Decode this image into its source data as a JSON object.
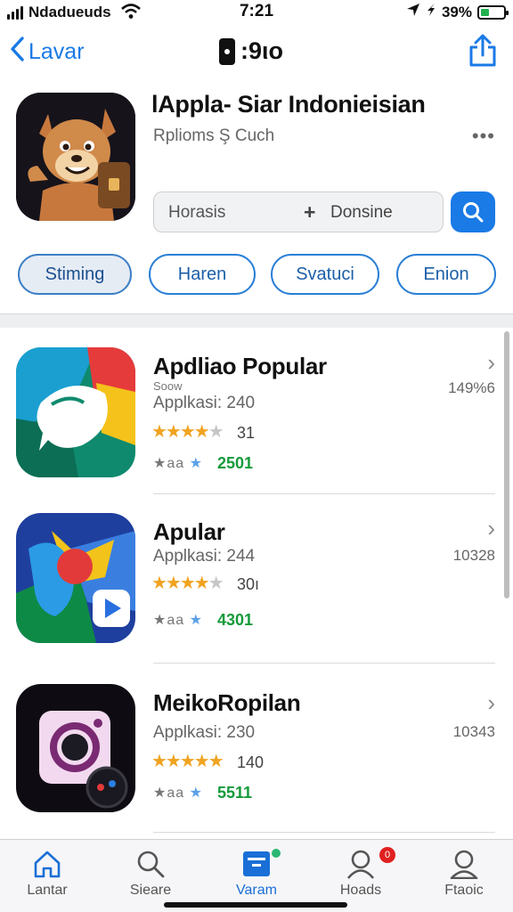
{
  "status_bar": {
    "carrier": "Ndadueuds",
    "time": "7:21",
    "battery": "39%",
    "battery_level": 0.39
  },
  "nav": {
    "back_label": "Lavar",
    "title": ":9ιo"
  },
  "header": {
    "title": "lAppla- Siar Indonieisian",
    "subtitle": "Rplioms Ş Cuch",
    "more": "•••"
  },
  "search": {
    "left_text": "Horasis",
    "plus": "+",
    "right_text": "Donsine"
  },
  "chips": [
    {
      "label": "Stiming",
      "active": true
    },
    {
      "label": "Haren",
      "active": false
    },
    {
      "label": "Svatuci",
      "active": false
    },
    {
      "label": "Enion",
      "active": false
    }
  ],
  "apps": [
    {
      "title": "Apdliao Popular",
      "sub": "Soow",
      "count": "Applkasi: 240",
      "stars": 4.5,
      "rating": "31",
      "mini": "★aa",
      "mini_blue": "★",
      "downloads": "2501",
      "size": "149%6"
    },
    {
      "title": "Apular",
      "sub": "",
      "count": "Applkasi: 244",
      "stars": 4.5,
      "rating": "30ı",
      "mini": "★aa",
      "mini_blue": "★",
      "downloads": "4301",
      "size": "10328"
    },
    {
      "title": "MeikoRopilan",
      "sub": "",
      "count": "Applkasi: 230",
      "stars": 5,
      "rating": "140",
      "mini": "★aa",
      "mini_blue": "★",
      "downloads": "5511",
      "size": "10343"
    }
  ],
  "tabs": [
    {
      "label": "Lantar",
      "icon": "home-icon",
      "active": false
    },
    {
      "label": "Sieare",
      "icon": "search-icon",
      "active": false
    },
    {
      "label": "Varam",
      "icon": "apps-icon",
      "active": true
    },
    {
      "label": "Hoads",
      "icon": "people-icon",
      "active": false
    },
    {
      "label": "Ftaoic",
      "icon": "profile-icon",
      "active": false
    }
  ],
  "colors": {
    "accent": "#1a7ae6",
    "star": "#f0a321",
    "downloads": "#159a3a",
    "badge_green": "#2bb673",
    "badge_red": "#e02020"
  }
}
